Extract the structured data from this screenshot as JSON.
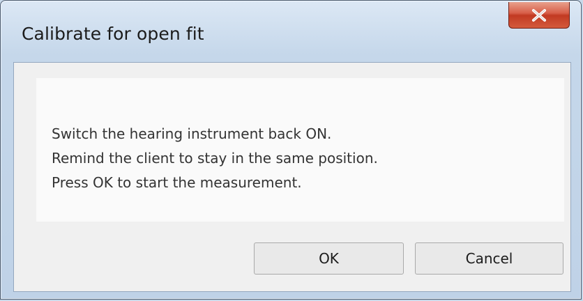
{
  "window": {
    "title": "Calibrate for open fit",
    "close_icon": "close-icon"
  },
  "message": {
    "lines": [
      "Switch the hearing instrument back ON.",
      "Remind the client to stay in the same position.",
      "Press OK to start the measurement."
    ]
  },
  "buttons": {
    "ok_label": "OK",
    "cancel_label": "Cancel"
  },
  "colors": {
    "close_button": "#c23a22",
    "frame": "#c5d7ea",
    "client_area": "#f0f0f0"
  }
}
